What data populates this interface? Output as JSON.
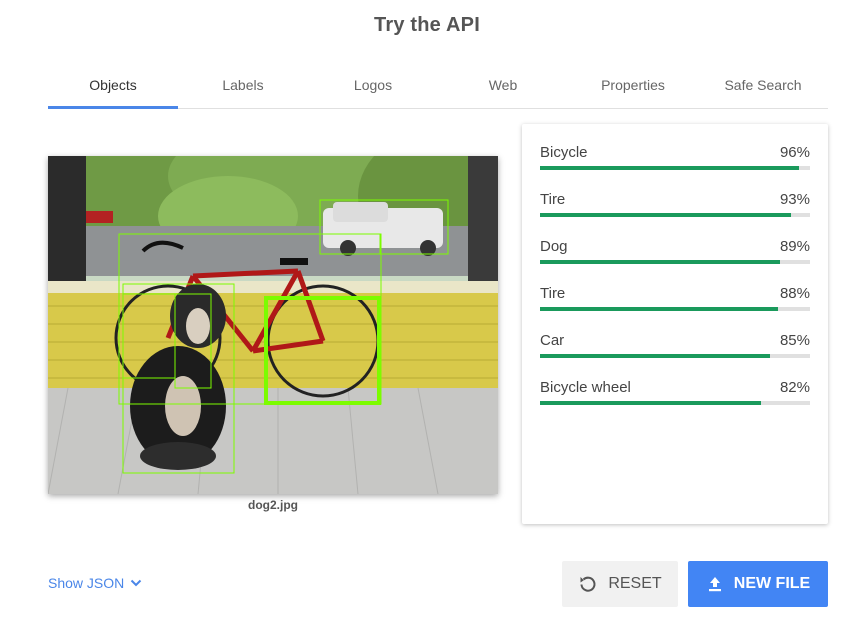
{
  "header": {
    "title": "Try the API"
  },
  "tabs": [
    {
      "label": "Objects",
      "active": true
    },
    {
      "label": "Labels",
      "active": false
    },
    {
      "label": "Logos",
      "active": false
    },
    {
      "label": "Web",
      "active": false
    },
    {
      "label": "Properties",
      "active": false
    },
    {
      "label": "Safe Search",
      "active": false
    }
  ],
  "image": {
    "filename": "dog2.jpg"
  },
  "results": [
    {
      "label": "Bicycle",
      "percent": "96%",
      "score": 0.96
    },
    {
      "label": "Tire",
      "percent": "93%",
      "score": 0.93
    },
    {
      "label": "Dog",
      "percent": "89%",
      "score": 0.89
    },
    {
      "label": "Tire",
      "percent": "88%",
      "score": 0.88
    },
    {
      "label": "Car",
      "percent": "85%",
      "score": 0.85
    },
    {
      "label": "Bicycle wheel",
      "percent": "82%",
      "score": 0.82
    }
  ],
  "footer": {
    "show_json": "Show JSON",
    "reset_label": "RESET",
    "new_file_label": "NEW FILE"
  },
  "colors": {
    "accent": "#4285f4",
    "bar": "#1a9a5c",
    "box": "#7cfc00"
  },
  "icons": {
    "show_json": "chevron-down-icon",
    "reset": "reset-icon",
    "new_file": "upload-icon"
  }
}
